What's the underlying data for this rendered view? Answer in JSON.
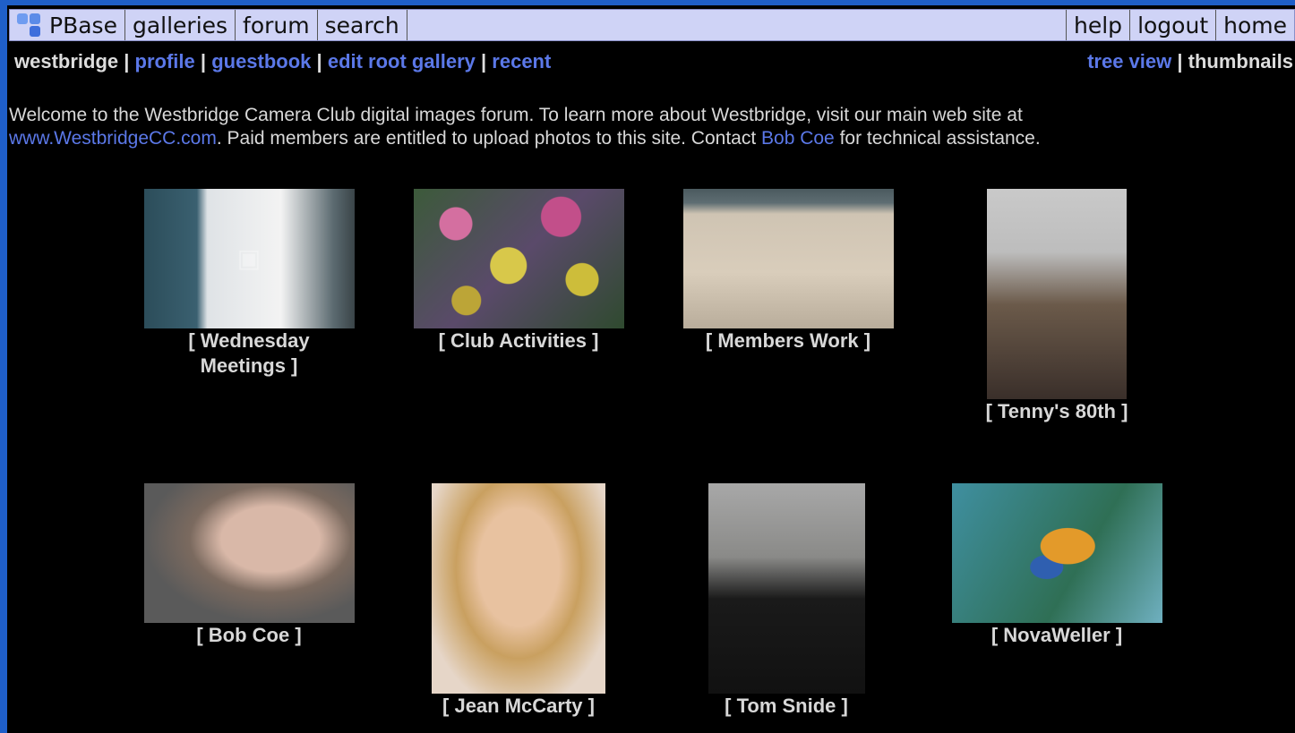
{
  "topbar": {
    "items": [
      "PBase",
      "galleries",
      "forum",
      "search"
    ],
    "right_items": [
      "help",
      "logout",
      "home"
    ]
  },
  "subnav": {
    "current": "westbridge",
    "links": [
      "profile",
      "guestbook",
      "edit root gallery",
      "recent"
    ],
    "view_link": "tree view",
    "view_current": "thumbnails"
  },
  "welcome": {
    "line1": "Welcome to the Westbridge Camera Club digital images forum. To learn more about Westbridge, visit our main web site at",
    "site_link": "www.WestbridgeCC.com",
    "line2_mid": ". Paid members are entitled to upload photos to this site. Contact ",
    "contact_link": "Bob Coe",
    "line2_end": " for technical assistance."
  },
  "galleries": [
    {
      "caption": "[ Wednesday Meetings ]"
    },
    {
      "caption": "[ Club Activities ]"
    },
    {
      "caption": "[ Members Work ]"
    },
    {
      "caption": "[ Tenny's 80th ]"
    },
    {
      "caption": "[ Bob Coe ]"
    },
    {
      "caption": "[ Jean McCarty ]"
    },
    {
      "caption": "[ Tom Snide ]"
    },
    {
      "caption": "[ NovaWeller ]"
    }
  ]
}
